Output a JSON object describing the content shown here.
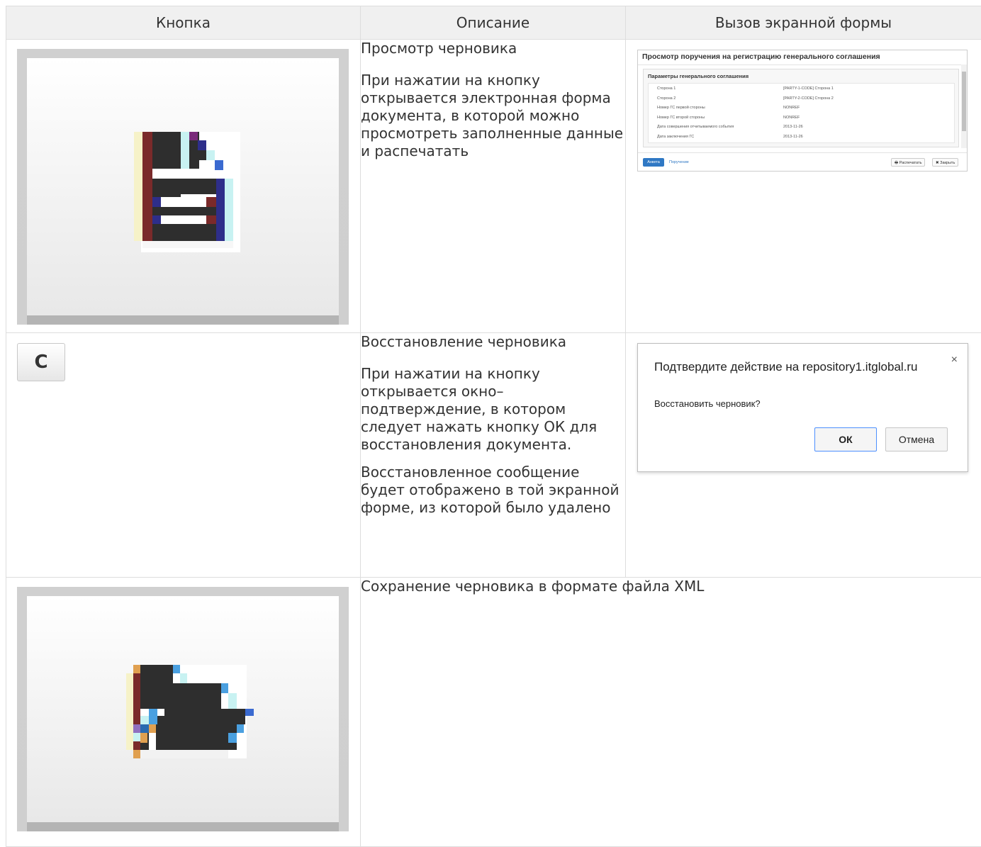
{
  "table": {
    "headers": [
      "Кнопка",
      "Описание",
      "Вызов экранной формы"
    ]
  },
  "rows": [
    {
      "button_icon": "view-draft-icon",
      "title": "Просмотр черновика",
      "description": "При нажатии на кнопку открывается электронная форма документа, в которой можно просмотреть заполненные данные и распечатать"
    },
    {
      "button_icon": "reload-icon",
      "button_glyph": "C",
      "title": "Восстановление черновика",
      "description": "При нажатии на кнопку открывается окно–подтверждение, в котором следует нажать кнопку ОК для восстановления документа.",
      "description2": "Восстановленное сообщение будет отображено в той экранной форме, из которой было удалено"
    },
    {
      "button_icon": "save-xml-icon",
      "title": "Сохранение черновика в формате файла XML"
    }
  ],
  "form_preview": {
    "title": "Просмотр поручения на регистрацию генерального соглашения",
    "panel_title": "Параметры генерального соглашения",
    "fields": [
      {
        "label": "Сторона 1",
        "value": "[PARTY-1-CODE] Сторона 1"
      },
      {
        "label": "Сторона 2",
        "value": "[PARTY-2-CODE] Сторона 2"
      },
      {
        "label": "Номер ГС первой стороны",
        "value": "NONREF"
      },
      {
        "label": "Номер ГС второй стороны",
        "value": "NONREF"
      },
      {
        "label": "Дата совершения отчитываемого события",
        "value": "2013-11-26"
      },
      {
        "label": "Дата заключения ГС",
        "value": "2013-11-26"
      }
    ],
    "tab_active": "Анкета",
    "tab_link": "Поручение",
    "print_label": "🖶 Распечатать",
    "close_label": "✖ Закрыть"
  },
  "confirm_dialog": {
    "title": "Подтвердите действие на repository1.itglobal.ru",
    "close_glyph": "×",
    "message": "Восстановить черновик?",
    "ok_label": "ОК",
    "cancel_label": "Отмена"
  },
  "colors": {
    "header_bg": "#f0f0f0",
    "border": "#dddddd",
    "accent_blue": "#2f78c4"
  }
}
